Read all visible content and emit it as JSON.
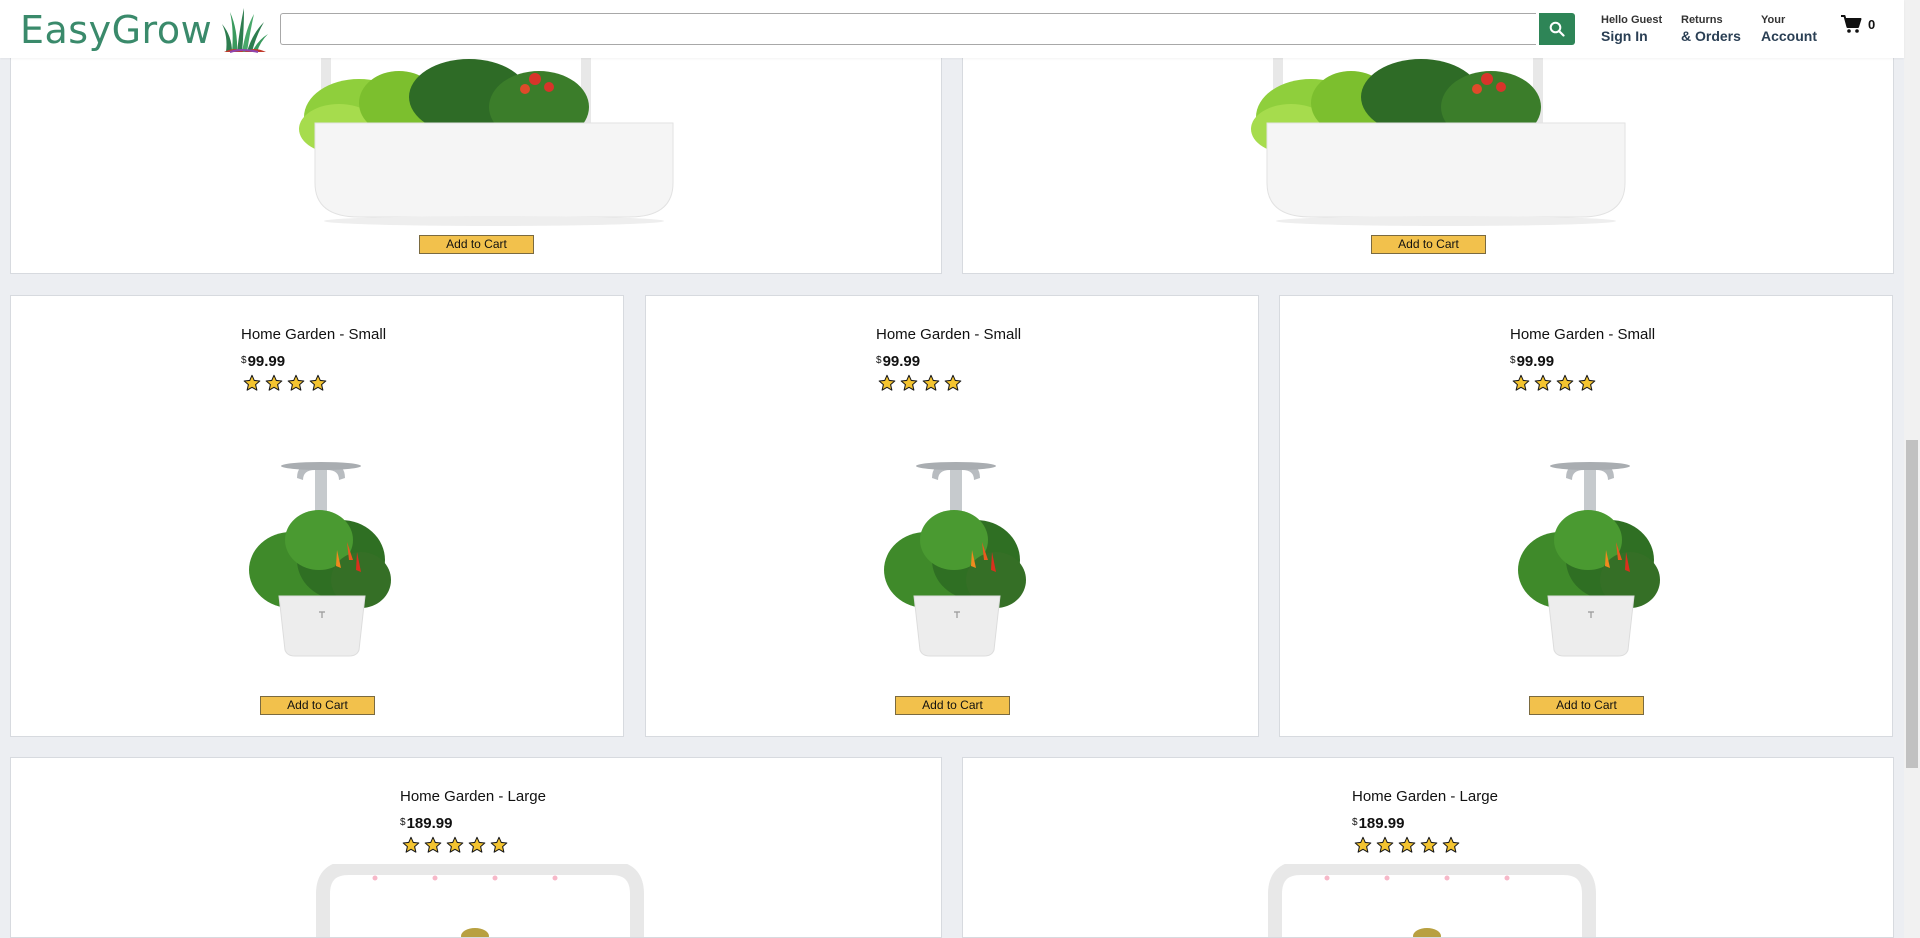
{
  "header": {
    "logo_text": "EasyGrow",
    "search": {
      "placeholder": "",
      "value": ""
    },
    "sign_in": {
      "small": "Hello Guest",
      "big": "Sign In"
    },
    "orders": {
      "small": "Returns",
      "big": "& Orders"
    },
    "account": {
      "small": "Your",
      "big": "Account"
    },
    "cart_count": "0"
  },
  "products_top": [
    {
      "button": "Add to Cart"
    },
    {
      "button": "Add to Cart"
    }
  ],
  "products_small": [
    {
      "name": "Home Garden - Small",
      "currency": "$",
      "price": "99.99",
      "rating": 4,
      "button": "Add to Cart"
    },
    {
      "name": "Home Garden - Small",
      "currency": "$",
      "price": "99.99",
      "rating": 4,
      "button": "Add to Cart"
    },
    {
      "name": "Home Garden - Small",
      "currency": "$",
      "price": "99.99",
      "rating": 4,
      "button": "Add to Cart"
    }
  ],
  "products_large": [
    {
      "name": "Home Garden - Large",
      "currency": "$",
      "price": "189.99",
      "rating": 5
    },
    {
      "name": "Home Garden - Large",
      "currency": "$",
      "price": "189.99",
      "rating": 5
    }
  ],
  "colors": {
    "brand": "#3a8a6b",
    "search_button": "#2e8557",
    "cart_button": "#f2c14c",
    "star": "#f4c430"
  }
}
